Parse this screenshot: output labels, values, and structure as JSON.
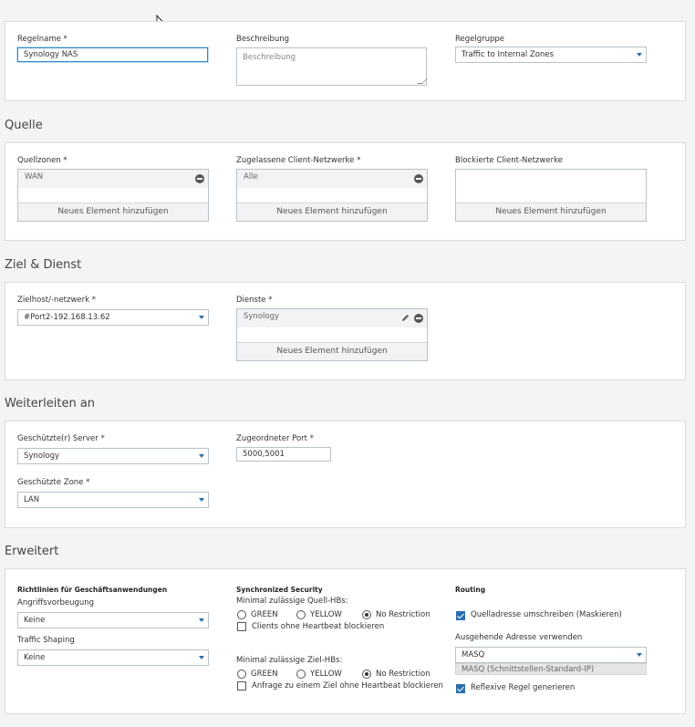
{
  "general": {
    "rule_name_label": "Regelname *",
    "rule_name_value": "Synology NAS",
    "description_label": "Beschreibung",
    "description_placeholder": "Beschreibung",
    "group_label": "Regelgruppe",
    "group_value": "Traffic to Internal Zones"
  },
  "source": {
    "title": "Quelle",
    "zones_label": "Quellzonen *",
    "zones_items": [
      "WAN"
    ],
    "networks_label": "Zugelassene Client-Netzwerke *",
    "networks_items": [
      "Alle"
    ],
    "blocked_label": "Blockierte Client-Netzwerke",
    "add_label": "Neues Element hinzufügen"
  },
  "destination": {
    "title": "Ziel & Dienst",
    "host_label": "Zielhost/-netzwerk *",
    "host_value": "#Port2-192.168.13.62",
    "services_label": "Dienste *",
    "services_items": [
      "Synology"
    ],
    "add_label": "Neues Element hinzufügen"
  },
  "forward": {
    "title": "Weiterleiten an",
    "server_label": "Geschützte(r) Server *",
    "server_value": "Synology",
    "port_label": "Zugeordneter Port *",
    "port_value": "5000,5001",
    "zone_label": "Geschützte Zone *",
    "zone_value": "LAN"
  },
  "advanced": {
    "title": "Erweitert",
    "policies_heading": "Richtlinien für Geschäftsanwendungen",
    "ips_label": "Angriffsvorbeugung",
    "ips_value": "Keine",
    "shaping_label": "Traffic Shaping",
    "shaping_value": "Keine",
    "sync_heading": "Synchronized Security",
    "src_hb_label": "Minimal zulässige Quell-HBs:",
    "dst_hb_label": "Minimal zulässige Ziel-HBs:",
    "hb_options": [
      "GREEN",
      "YELLOW",
      "No Restriction"
    ],
    "src_block_label": "Clients ohne Heartbeat blockieren",
    "dst_block_label": "Anfrage zu einem Ziel ohne Heartbeat blockieren",
    "routing_heading": "Routing",
    "masq_label": "Quelladresse umschreiben (Maskieren)",
    "outgoing_label": "Ausgehende Adresse verwenden",
    "outgoing_value": "MASQ",
    "outgoing_hint": "MASQ (Schnittstellen-Standard-IP)",
    "reflexive_label": "Reflexive Regel generieren"
  }
}
